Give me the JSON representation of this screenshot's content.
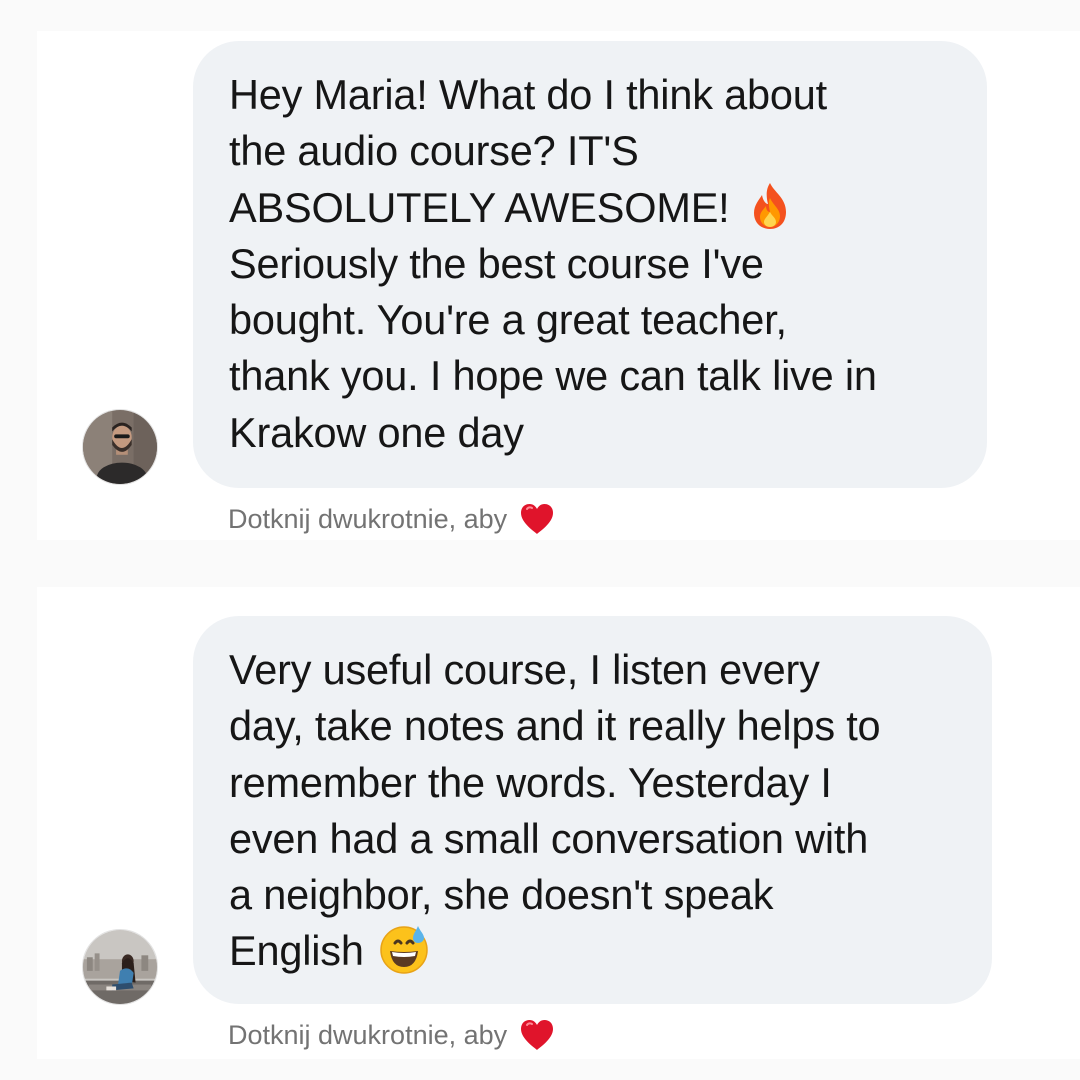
{
  "messages": [
    {
      "avatar_icon": "avatar-man-bearded",
      "lines": [
        "Hey Maria! What do I think about",
        "the audio course? IT'S",
        "ABSOLUTELY AWESOME!",
        "Seriously the best course I've",
        "bought. You're a great teacher,",
        "thank you. I hope we can talk live in",
        "Krakow one day"
      ],
      "emoji": "fire-emoji",
      "hint": "Dotknij dwukrotnie, aby",
      "hint_icon": "heart-icon"
    },
    {
      "avatar_icon": "avatar-woman-city",
      "lines": [
        "Very useful course, I listen every",
        "day, take notes and it really helps to",
        "remember the words. Yesterday I",
        "even had a small conversation with",
        "a neighbor, she doesn't speak",
        "English"
      ],
      "emoji": "grinning-sweat-emoji",
      "hint": "Dotknij dwukrotnie, aby",
      "hint_icon": "heart-icon"
    }
  ],
  "colors": {
    "page_background": "#fafafa",
    "card_background": "#ffffff",
    "bubble_background": "#eff2f5",
    "message_text": "#161616",
    "hint_text": "#737373",
    "heart": "#e0142b"
  }
}
